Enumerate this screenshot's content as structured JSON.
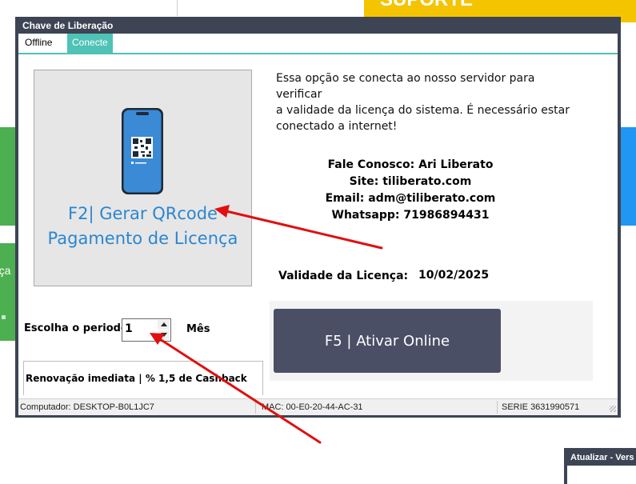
{
  "background": {
    "top_banner_text": "SUPORTE",
    "side_fragment_text": "rça",
    "update_window_title": "Atualizar - Vers"
  },
  "dialog": {
    "title": "Chave de Liberação",
    "tabs": [
      {
        "label": "Offline"
      },
      {
        "label": "Conecte",
        "active": true
      }
    ],
    "qr_button": {
      "line1": "F2| Gerar QRcode",
      "line2": "Pagamento de Licença",
      "icon": "phone-qrcode-icon"
    },
    "info": {
      "line1": "Essa opção se conecta ao nosso servidor para verificar",
      "line2": "a validade da licença do sistema. É necessário estar",
      "line3": "conectado a internet!"
    },
    "contact": {
      "line1": "Fale Conosco: Ari Liberato",
      "line2": "Site: tiliberato.com",
      "line3": "Email: adm@tiliberato.com",
      "line4": "Whatsapp: 71986894431"
    },
    "validity": {
      "label": "Validade da Licença:",
      "value": "10/02/2025"
    },
    "online_button": {
      "label": "F5 | Ativar Online"
    },
    "period": {
      "label": "Escolha o periodo:",
      "value": "1",
      "unit": "Mês"
    },
    "renewal_text": "Renovação imediata | % 1,5 de Cashback",
    "status_bar": {
      "computer": "Computador: DESKTOP-B0L1JC7",
      "mac": "MAC:  00-E0-20-44-AC-31",
      "serie": "SERIE 3631990571"
    }
  },
  "colors": {
    "window_frame": "#3d4454",
    "tab_active": "#4fc3b6",
    "qr_text": "#2a86d1",
    "online_button": "#4a4f66",
    "annotation_arrow": "#e01010"
  }
}
